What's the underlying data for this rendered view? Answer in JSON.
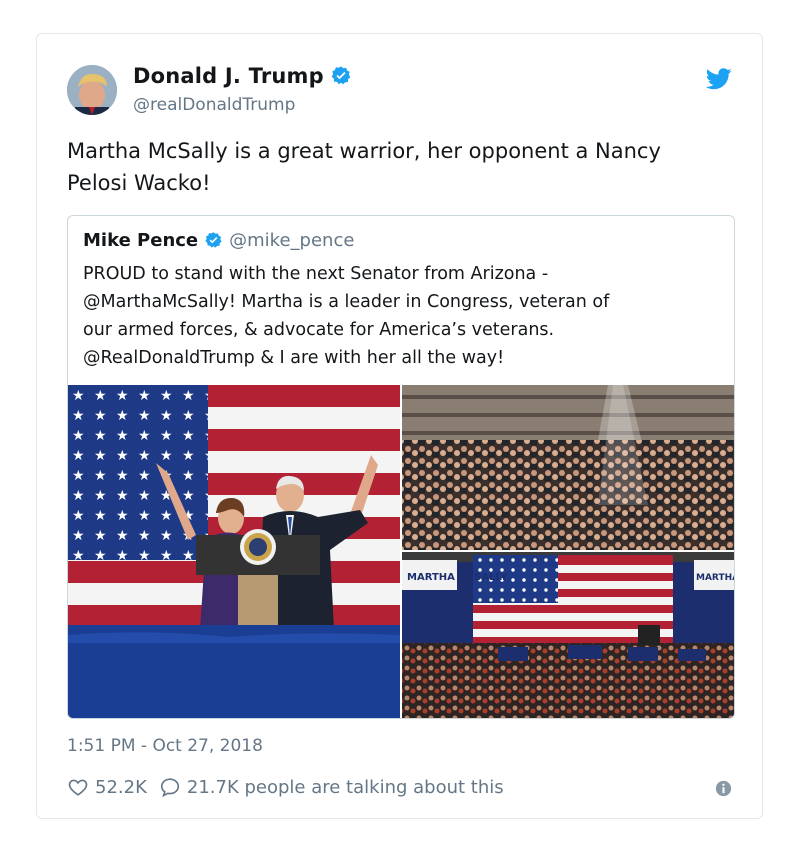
{
  "author": {
    "name": "Donald J. Trump",
    "handle": "@realDonaldTrump"
  },
  "tweet": {
    "text_line1": "Martha McSally is a great warrior, her opponent a Nancy",
    "text_line2": "Pelosi Wacko!"
  },
  "quoted": {
    "name": "Mike Pence",
    "handle": "@mike_pence",
    "line1": "PROUD to stand with the next Senator from Arizona -",
    "line2": "@MarthaMcSally! Martha is a leader in Congress, veteran of",
    "line3": "our armed forces, & advocate for America’s veterans.",
    "line4": "@RealDonaldTrump & I are with her all the way!",
    "sign_left": "MARTHA McSALLY",
    "sign_right": "MARTHA McSA"
  },
  "meta": {
    "timestamp": "1:51 PM - Oct 27, 2018",
    "likes": "52.2K",
    "talking": "21.7K people are talking about this"
  },
  "icons": [
    "verified-icon",
    "twitter-bird-icon",
    "heart-icon",
    "speech-bubble-icon",
    "info-icon"
  ],
  "colors": {
    "twitter_blue": "#1da1f2",
    "secondary_text": "#657786",
    "border": "#e1e8ed"
  }
}
